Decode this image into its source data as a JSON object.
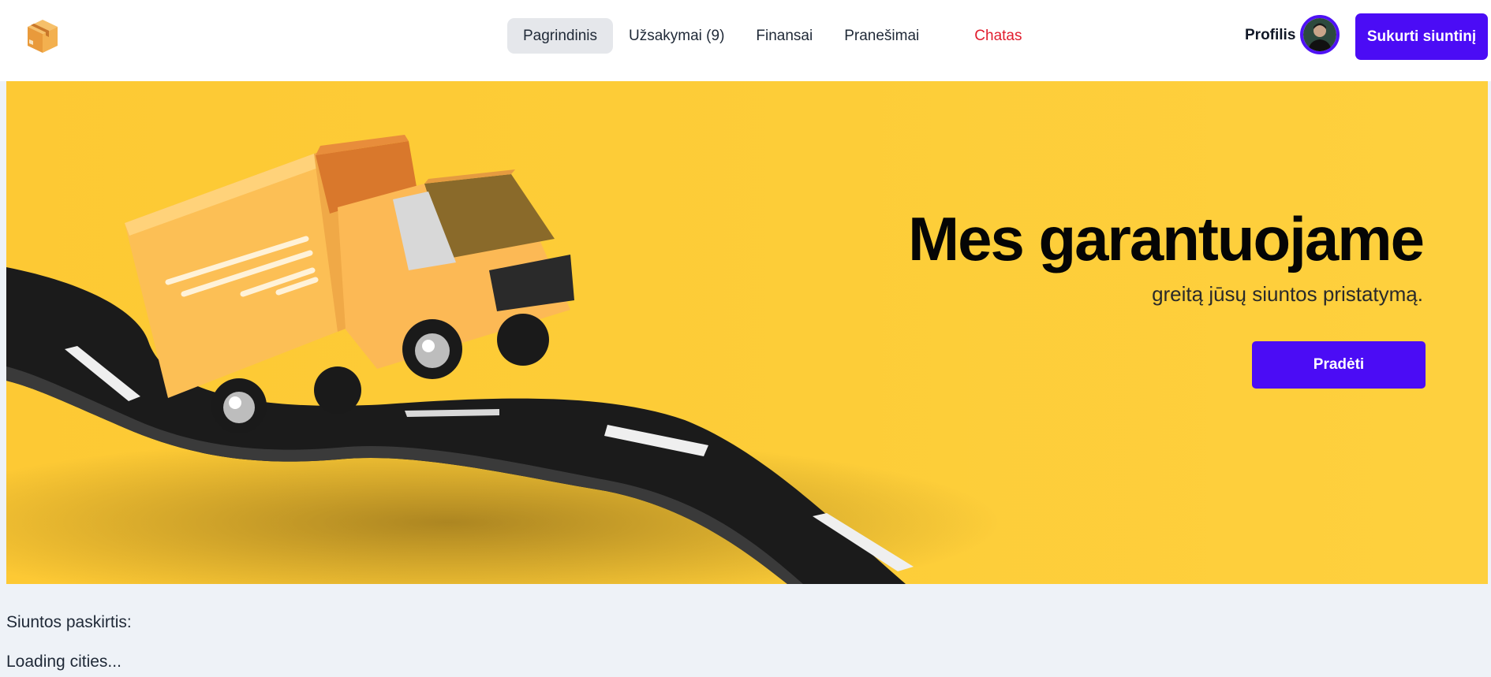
{
  "header": {
    "logo_icon": "package-box-icon",
    "nav": [
      {
        "label": "Pagrindinis",
        "active": true
      },
      {
        "label": "Užsakymai (9)",
        "active": false
      },
      {
        "label": "Finansai",
        "active": false
      },
      {
        "label": "Pranešimai",
        "active": false
      },
      {
        "label": "Chatas",
        "active": false,
        "color": "#e11d2e"
      }
    ],
    "profile_label": "Profilis",
    "avatar_icon": "user-avatar",
    "create_button": "Sukurti siuntinį"
  },
  "hero": {
    "title": "Mes garantuojame",
    "subtitle": "greitą jūsų siuntos pristatymą.",
    "button": "Pradėti",
    "image_icon": "delivery-truck-on-road-illustration"
  },
  "content": {
    "destination_label": "Siuntos paskirtis:",
    "loading_text": "Loading cities..."
  },
  "colors": {
    "accent": "#4b0cf5",
    "hero_bg": "#fdc934",
    "chat": "#e11d2e"
  }
}
